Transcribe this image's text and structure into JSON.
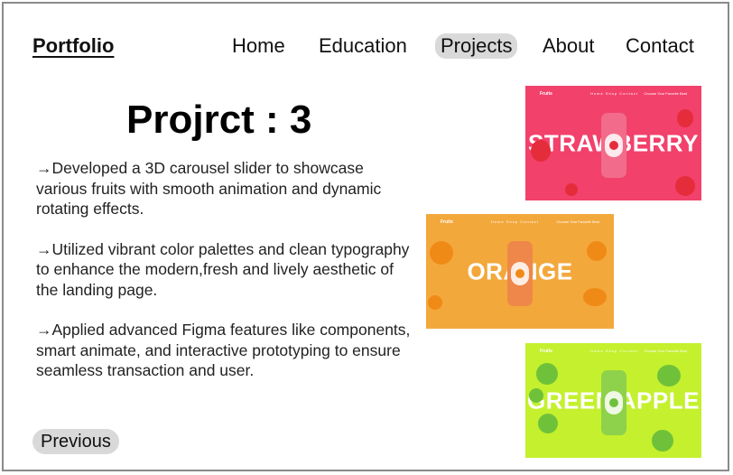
{
  "header": {
    "logo": "Portfolio",
    "nav": [
      "Home",
      "Education",
      "Projects",
      "About",
      "Contact"
    ],
    "active_nav": "Projects"
  },
  "main": {
    "title": "Projrct : 3",
    "paragraphs": [
      "→Developed a 3D carousel slider to showcase various fruits with smooth animation and dynamic rotating effects.",
      "→Utilized vibrant color palettes and clean typography to enhance the modern,fresh and lively aesthetic of the landing page.",
      "→Applied advanced Figma features like components, smart animate, and interactive prototyping to ensure seamless  transaction and user."
    ],
    "previous_label": "Previous"
  },
  "gallery": [
    {
      "name": "strawberry",
      "heading": "STRAWBERRY",
      "bg": "#f2416b",
      "can": "#f26b8a",
      "fruit": "#e42c3b",
      "mini_logo": "Fruits",
      "mini_nav": "Home  Shop  Contact",
      "mini_cta": "Choose Your Favorite Best"
    },
    {
      "name": "orange",
      "heading": "ORANGE",
      "bg": "#f3a83c",
      "can": "#f0874a",
      "fruit": "#f08a17",
      "mini_logo": "Fruits",
      "mini_nav": "Home  Shop  Contact",
      "mini_cta": "Choose Your Favorite Best"
    },
    {
      "name": "green-apple",
      "heading": "GREEN APPLE",
      "bg": "#c4f02e",
      "can": "#8ed14a",
      "fruit": "#6fc13a",
      "mini_logo": "Fruits",
      "mini_nav": "Home  Shop  Contact",
      "mini_cta": "Choose Your Favorite Best"
    }
  ]
}
